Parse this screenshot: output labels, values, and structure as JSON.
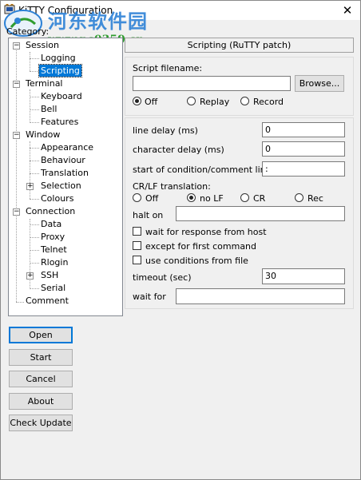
{
  "window": {
    "title": "KiTTY Configuration",
    "close_glyph": "✕"
  },
  "watermark": {
    "cn_text": "河东软件园",
    "url": "www.pc0359.cn"
  },
  "tree": {
    "category_label": "Category:",
    "items": [
      {
        "label": "Session"
      },
      {
        "label": "Logging"
      },
      {
        "label": "Scripting"
      },
      {
        "label": "Terminal"
      },
      {
        "label": "Keyboard"
      },
      {
        "label": "Bell"
      },
      {
        "label": "Features"
      },
      {
        "label": "Window"
      },
      {
        "label": "Appearance"
      },
      {
        "label": "Behaviour"
      },
      {
        "label": "Translation"
      },
      {
        "label": "Selection"
      },
      {
        "label": "Colours"
      },
      {
        "label": "Connection"
      },
      {
        "label": "Data"
      },
      {
        "label": "Proxy"
      },
      {
        "label": "Telnet"
      },
      {
        "label": "Rlogin"
      },
      {
        "label": "SSH"
      },
      {
        "label": "Serial"
      },
      {
        "label": "Comment"
      }
    ],
    "selected": "Scripting",
    "expander_glyph": "+",
    "collapse_glyph": "−"
  },
  "buttons": {
    "open": "Open",
    "start": "Start",
    "cancel": "Cancel",
    "about": "About",
    "check_update": "Check Update"
  },
  "panel": {
    "header": "Scripting (RuTTY patch)",
    "script_filename_label": "Script filename:",
    "script_filename_value": "",
    "browse_label": "Browse...",
    "mode_options": [
      "Off",
      "Replay",
      "Record"
    ],
    "mode_selected": "Off",
    "line_delay_label": "line delay (ms)",
    "line_delay_value": "0",
    "char_delay_label": "character delay (ms)",
    "char_delay_value": "0",
    "cond_comment_label": "start of condition/comment line",
    "cond_comment_value": ":",
    "crlf_label": "CR/LF translation:",
    "crlf_options": [
      "Off",
      "no LF",
      "CR",
      "Rec"
    ],
    "crlf_selected": "no LF",
    "halt_on_label": "halt on",
    "halt_on_value": "",
    "checkboxes": [
      {
        "label": "wait for response from host",
        "checked": false
      },
      {
        "label": "except for first command",
        "checked": false
      },
      {
        "label": "use conditions from file",
        "checked": false
      }
    ],
    "timeout_label": "timeout (sec)",
    "timeout_value": "30",
    "wait_for_label": "wait for",
    "wait_for_value": ""
  }
}
